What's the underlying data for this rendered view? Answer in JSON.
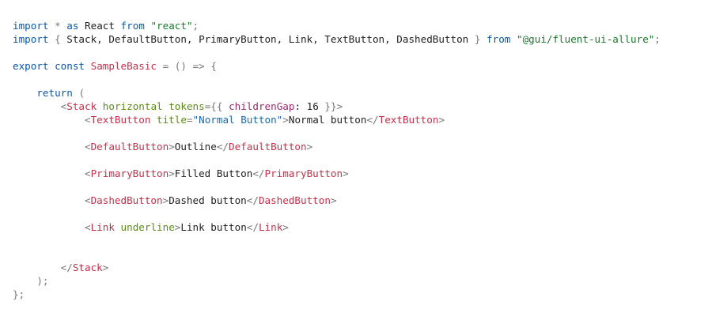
{
  "code_lines": [
    {
      "tokens": [
        {
          "t": "import",
          "c": "kw"
        },
        {
          "t": " ",
          "c": "txt"
        },
        {
          "t": "*",
          "c": "op"
        },
        {
          "t": " ",
          "c": "txt"
        },
        {
          "t": "as",
          "c": "kw"
        },
        {
          "t": " React ",
          "c": "txt"
        },
        {
          "t": "from",
          "c": "kw"
        },
        {
          "t": " ",
          "c": "txt"
        },
        {
          "t": "\"react\"",
          "c": "str"
        },
        {
          "t": ";",
          "c": "pun"
        }
      ]
    },
    {
      "tokens": [
        {
          "t": "import",
          "c": "kw"
        },
        {
          "t": " ",
          "c": "txt"
        },
        {
          "t": "{",
          "c": "pun"
        },
        {
          "t": " Stack, DefaultButton, PrimaryButton, Link, TextButton, DashedButton ",
          "c": "txt"
        },
        {
          "t": "}",
          "c": "pun"
        },
        {
          "t": " ",
          "c": "txt"
        },
        {
          "t": "from",
          "c": "kw"
        },
        {
          "t": " ",
          "c": "txt"
        },
        {
          "t": "\"@gui/fluent-ui-allure\"",
          "c": "str"
        },
        {
          "t": ";",
          "c": "pun"
        }
      ]
    },
    {
      "tokens": []
    },
    {
      "tokens": [
        {
          "t": "export",
          "c": "kw"
        },
        {
          "t": " ",
          "c": "txt"
        },
        {
          "t": "const",
          "c": "kw"
        },
        {
          "t": " ",
          "c": "txt"
        },
        {
          "t": "SampleBasic",
          "c": "fn"
        },
        {
          "t": " ",
          "c": "txt"
        },
        {
          "t": "=",
          "c": "op"
        },
        {
          "t": " ",
          "c": "txt"
        },
        {
          "t": "()",
          "c": "pun"
        },
        {
          "t": " ",
          "c": "txt"
        },
        {
          "t": "=>",
          "c": "op"
        },
        {
          "t": " ",
          "c": "txt"
        },
        {
          "t": "{",
          "c": "pun"
        }
      ]
    },
    {
      "tokens": []
    },
    {
      "tokens": [
        {
          "t": "    ",
          "c": "txt"
        },
        {
          "t": "return",
          "c": "kw"
        },
        {
          "t": " ",
          "c": "txt"
        },
        {
          "t": "(",
          "c": "pun"
        }
      ]
    },
    {
      "tokens": [
        {
          "t": "        ",
          "c": "txt"
        },
        {
          "t": "<",
          "c": "pun"
        },
        {
          "t": "Stack",
          "c": "tag"
        },
        {
          "t": " ",
          "c": "txt"
        },
        {
          "t": "horizontal",
          "c": "attr"
        },
        {
          "t": " ",
          "c": "txt"
        },
        {
          "t": "tokens",
          "c": "attr"
        },
        {
          "t": "=",
          "c": "op"
        },
        {
          "t": "{{",
          "c": "pun"
        },
        {
          "t": " ",
          "c": "txt"
        },
        {
          "t": "childrenGap",
          "c": "prop"
        },
        {
          "t": ":",
          "c": "txt"
        },
        {
          "t": " 16 ",
          "c": "num"
        },
        {
          "t": "}}",
          "c": "pun"
        },
        {
          "t": ">",
          "c": "pun"
        }
      ]
    },
    {
      "tokens": [
        {
          "t": "            ",
          "c": "txt"
        },
        {
          "t": "<",
          "c": "pun"
        },
        {
          "t": "TextButton",
          "c": "tag"
        },
        {
          "t": " ",
          "c": "txt"
        },
        {
          "t": "title",
          "c": "attr"
        },
        {
          "t": "=",
          "c": "op"
        },
        {
          "t": "\"Normal Button\"",
          "c": "strA"
        },
        {
          "t": ">",
          "c": "pun"
        },
        {
          "t": "Normal button",
          "c": "txt"
        },
        {
          "t": "</",
          "c": "pun"
        },
        {
          "t": "TextButton",
          "c": "tag"
        },
        {
          "t": ">",
          "c": "pun"
        }
      ]
    },
    {
      "tokens": []
    },
    {
      "tokens": [
        {
          "t": "            ",
          "c": "txt"
        },
        {
          "t": "<",
          "c": "pun"
        },
        {
          "t": "DefaultButton",
          "c": "tag"
        },
        {
          "t": ">",
          "c": "pun"
        },
        {
          "t": "Outline",
          "c": "txt"
        },
        {
          "t": "</",
          "c": "pun"
        },
        {
          "t": "DefaultButton",
          "c": "tag"
        },
        {
          "t": ">",
          "c": "pun"
        }
      ]
    },
    {
      "tokens": []
    },
    {
      "tokens": [
        {
          "t": "            ",
          "c": "txt"
        },
        {
          "t": "<",
          "c": "pun"
        },
        {
          "t": "PrimaryButton",
          "c": "tag"
        },
        {
          "t": ">",
          "c": "pun"
        },
        {
          "t": "Filled Button",
          "c": "txt"
        },
        {
          "t": "</",
          "c": "pun"
        },
        {
          "t": "PrimaryButton",
          "c": "tag"
        },
        {
          "t": ">",
          "c": "pun"
        }
      ]
    },
    {
      "tokens": []
    },
    {
      "tokens": [
        {
          "t": "            ",
          "c": "txt"
        },
        {
          "t": "<",
          "c": "pun"
        },
        {
          "t": "DashedButton",
          "c": "tag"
        },
        {
          "t": ">",
          "c": "pun"
        },
        {
          "t": "Dashed button",
          "c": "txt"
        },
        {
          "t": "</",
          "c": "pun"
        },
        {
          "t": "DashedButton",
          "c": "tag"
        },
        {
          "t": ">",
          "c": "pun"
        }
      ]
    },
    {
      "tokens": []
    },
    {
      "tokens": [
        {
          "t": "            ",
          "c": "txt"
        },
        {
          "t": "<",
          "c": "pun"
        },
        {
          "t": "Link",
          "c": "tag"
        },
        {
          "t": " ",
          "c": "txt"
        },
        {
          "t": "underline",
          "c": "attr"
        },
        {
          "t": ">",
          "c": "pun"
        },
        {
          "t": "Link button",
          "c": "txt"
        },
        {
          "t": "</",
          "c": "pun"
        },
        {
          "t": "Link",
          "c": "tag"
        },
        {
          "t": ">",
          "c": "pun"
        }
      ]
    },
    {
      "tokens": []
    },
    {
      "tokens": []
    },
    {
      "tokens": [
        {
          "t": "        ",
          "c": "txt"
        },
        {
          "t": "</",
          "c": "pun"
        },
        {
          "t": "Stack",
          "c": "tag"
        },
        {
          "t": ">",
          "c": "pun"
        }
      ]
    },
    {
      "tokens": [
        {
          "t": "    ",
          "c": "txt"
        },
        {
          "t": ");",
          "c": "pun"
        }
      ]
    },
    {
      "tokens": [
        {
          "t": "};",
          "c": "pun"
        }
      ]
    }
  ],
  "colors": {
    "background": "#ffffff",
    "keyword": "#0b57a8",
    "string": "#197a2b",
    "tag": "#c5304a",
    "attribute": "#5b8a16",
    "attribute_string": "#1a67b3",
    "punctuation": "#777777",
    "text": "#1f1f1f"
  }
}
